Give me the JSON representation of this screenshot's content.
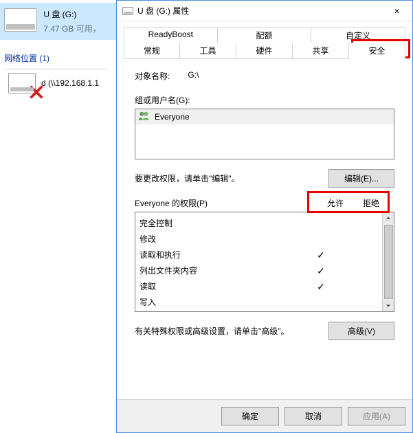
{
  "explorer": {
    "drive_label": "U 盘 (G:)",
    "drive_sub": "7.47 GB 可用，",
    "section_title": "网络位置 (1)",
    "network_label": "d (\\\\192.168.1.1"
  },
  "dialog": {
    "title": "U 盘 (G:) 属性",
    "close_icon": "×",
    "tabs_row1": [
      "ReadyBoost",
      "配额",
      "自定义"
    ],
    "tabs_row2": [
      "常规",
      "工具",
      "硬件",
      "共享",
      "安全"
    ],
    "active_tab": "安全",
    "object_name_label": "对象名称:",
    "object_name_value": "G:\\",
    "group_label": "组或用户名(G):",
    "groups": [
      {
        "name": "Everyone"
      }
    ],
    "edit_hint": "要更改权限，请单击\"编辑\"。",
    "edit_button": "编辑(E)...",
    "perm_header_label": "Everyone 的权限(P)",
    "allow_label": "允许",
    "deny_label": "拒绝",
    "permissions": [
      {
        "name": "完全控制",
        "allow": false,
        "deny": false
      },
      {
        "name": "修改",
        "allow": false,
        "deny": false
      },
      {
        "name": "读取和执行",
        "allow": true,
        "deny": false
      },
      {
        "name": "列出文件夹内容",
        "allow": true,
        "deny": false
      },
      {
        "name": "读取",
        "allow": true,
        "deny": false
      },
      {
        "name": "写入",
        "allow": false,
        "deny": false
      }
    ],
    "advanced_hint": "有关特殊权限或高级设置，请单击\"高级\"。",
    "advanced_button": "高级(V)",
    "ok_button": "确定",
    "cancel_button": "取消",
    "apply_button": "应用(A)"
  }
}
